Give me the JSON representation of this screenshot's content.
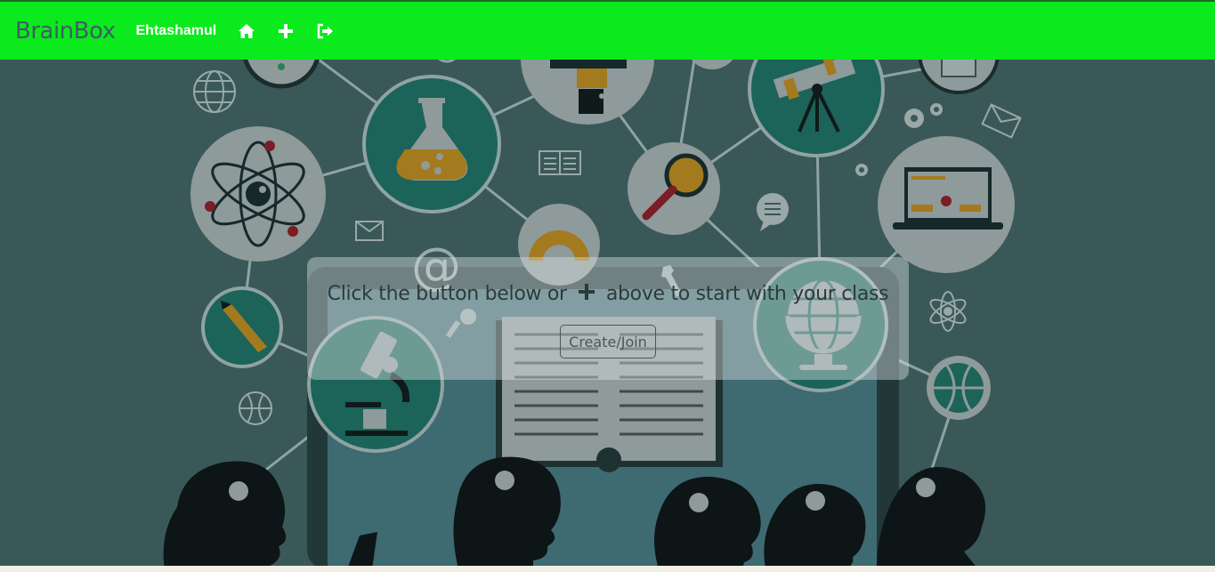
{
  "navbar": {
    "brand": "BrainBox",
    "username": "Ehtashamul",
    "icons": [
      "home-icon",
      "plus-icon",
      "sign-out-icon"
    ],
    "background": "#0bea1d"
  },
  "hero": {
    "message_before": "Click the button below or",
    "message_after": "above to start with your class",
    "button_label": "Create/Join",
    "background": "#3a5858"
  }
}
